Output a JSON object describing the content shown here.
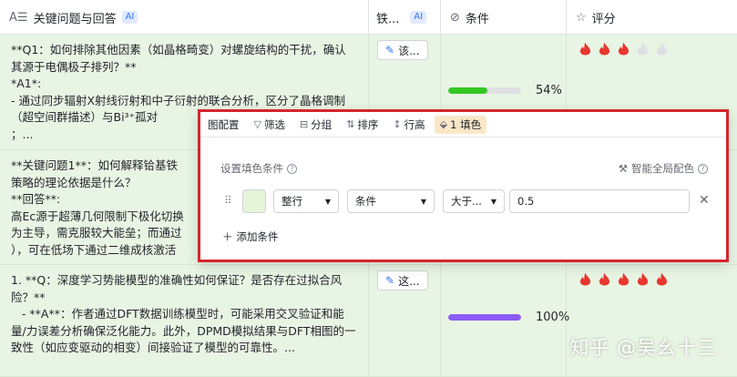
{
  "header": {
    "col_question": "关键问题与回答",
    "col_question_ai": "AI",
    "col_type": "铁...",
    "col_type_ai": "AI",
    "col_condition": "条件",
    "col_score": "评分"
  },
  "rows": [
    {
      "text": "**Q1：如何排除其他因素（如晶格畸变）对螺旋结构的干扰，确认其源于电偶极子排列？**\n*A1*:\n- 通过同步辐射X射线衍射和中子衍射的联合分析，区分了晶格调制（超空间群描述）与Bi³⁺孤对\n；...",
      "tag": "该...",
      "progress": 54,
      "progress_label": "54%",
      "bar_color": "#34c724",
      "score": 3
    },
    {
      "text": "**关键问题1**：如何解释铪基铁\n策略的理论依据是什么？\n**回答**:\n高Ec源于超薄几何限制下极化切换\n为主导，需克服较大能垒；而通过\n），可在低场下通过二维成核激活",
      "tag": "",
      "progress": null,
      "progress_label": "",
      "bar_color": "",
      "score": null
    },
    {
      "text": "1. **Q：深度学习势能模型的准确性如何保证？是否存在过拟合风险？**\n   - **A**：作者通过DFT数据训练模型时，可能采用交叉验证和能量/力误差分析确保泛化能力。此外，DPMD模拟结果与DFT相图的一致性（如应变驱动的相变）间接验证了模型的可靠性。...",
      "tag": "这...",
      "progress": 100,
      "progress_label": "100%",
      "bar_color": "#8b5cf6",
      "score": 5
    }
  ],
  "popup": {
    "tabs": [
      "图配置",
      "筛选",
      "分组",
      "排序",
      "行高",
      "1 填色"
    ],
    "fill_title": "设置填色条件",
    "smart_label": "智能全局配色",
    "scope": "整行",
    "field": "条件",
    "operator": "大于...",
    "value": "0.5",
    "add_label": "添加条件"
  },
  "watermark": "知乎 @吴幺十三",
  "colors": {
    "row_bg": "#e9f5e4",
    "flame_on": "#e8372e",
    "flame_off": "#dcdfe3",
    "highlight_border": "#d4262b"
  }
}
